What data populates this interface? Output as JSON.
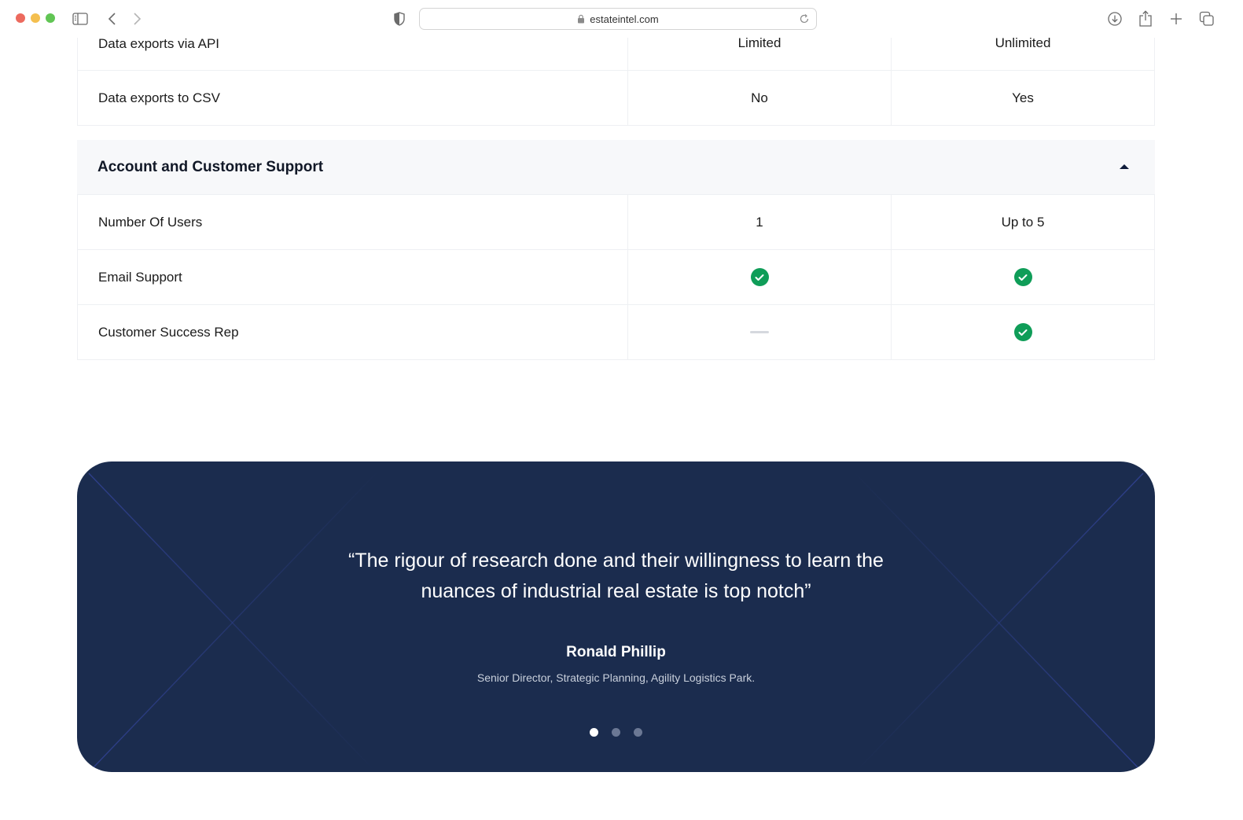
{
  "browser": {
    "url": "estateintel.com",
    "icons": [
      "sidebar-icon",
      "back-icon",
      "forward-icon",
      "privacy-shield-icon",
      "lock-icon",
      "reload-icon",
      "download-icon",
      "share-icon",
      "new-tab-icon",
      "tab-overview-icon"
    ]
  },
  "comparison": {
    "top_rows": [
      {
        "feature": "Data exports via API",
        "plan1": "Limited",
        "plan2": "Unlimited"
      },
      {
        "feature": "Data exports to CSV",
        "plan1": "No",
        "plan2": "Yes"
      }
    ],
    "section": {
      "title": "Account and Customer Support",
      "expanded": true,
      "rows": [
        {
          "feature": "Number Of Users",
          "plan1": "1",
          "plan2": "Up to 5"
        },
        {
          "feature": "Email Support",
          "plan1": "check",
          "plan2": "check"
        },
        {
          "feature": "Customer Success Rep",
          "plan1": "dash",
          "plan2": "check"
        }
      ]
    }
  },
  "testimonial": {
    "quote_line1": "“The rigour of research done and their willingness to learn the",
    "quote_line2": "nuances of industrial real estate is top notch”",
    "author": "Ronald Phillip",
    "role": "Senior Director, Strategic Planning, Agility Logistics Park.",
    "slides": 3,
    "active_slide": 1
  },
  "colors": {
    "card_bg": "#1b2c4e",
    "check_green": "#0f9d58",
    "section_bg": "#f7f8fa",
    "deco_line": "#2e3f8a"
  }
}
